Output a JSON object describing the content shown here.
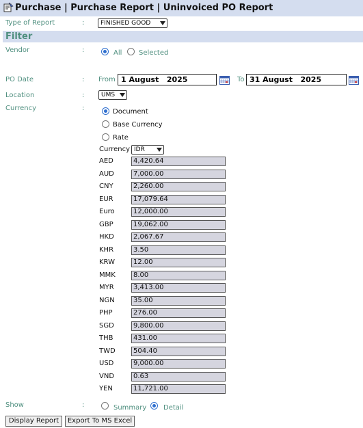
{
  "header": {
    "title": "Purchase | Purchase Report | Uninvoiced PO Report",
    "icon": "report-icon"
  },
  "type_of_report": {
    "label": "Type of Report",
    "colon": ":",
    "value": "FINISHED GOOD"
  },
  "filter": {
    "title": "Filter"
  },
  "vendor": {
    "label": "Vendor",
    "colon": ":",
    "options": [
      {
        "label": "All",
        "checked": true
      },
      {
        "label": "Selected",
        "checked": false
      }
    ]
  },
  "po_date": {
    "label": "PO Date",
    "colon": ":",
    "from_label": "From",
    "from_value": "1 August   2025",
    "to_label": "To",
    "to_value": "31 August   2025"
  },
  "location": {
    "label": "Location",
    "colon": ":",
    "value": "UMS"
  },
  "currency": {
    "label": "Currency",
    "colon": ":",
    "options": [
      {
        "label": "Document",
        "checked": true
      },
      {
        "label": "Base Currency",
        "checked": false
      },
      {
        "label": "Rate",
        "checked": false
      }
    ],
    "rate_currency_label": "Currency",
    "rate_currency_value": "IDR",
    "rates": [
      {
        "code": "AED",
        "value": "4,420.64"
      },
      {
        "code": "AUD",
        "value": "7,000.00"
      },
      {
        "code": "CNY",
        "value": "2,260.00"
      },
      {
        "code": "EUR",
        "value": "17,079.64"
      },
      {
        "code": "Euro",
        "value": "12,000.00"
      },
      {
        "code": "GBP",
        "value": "19,062.00"
      },
      {
        "code": "HKD",
        "value": "2,067.67"
      },
      {
        "code": "KHR",
        "value": "3.50"
      },
      {
        "code": "KRW",
        "value": "12.00"
      },
      {
        "code": "MMK",
        "value": "8.00"
      },
      {
        "code": "MYR",
        "value": "3,413.00"
      },
      {
        "code": "NGN",
        "value": "35.00"
      },
      {
        "code": "PHP",
        "value": "276.00"
      },
      {
        "code": "SGD",
        "value": "9,800.00"
      },
      {
        "code": "THB",
        "value": "431.00"
      },
      {
        "code": "TWD",
        "value": "504.40"
      },
      {
        "code": "USD",
        "value": "9,000.00"
      },
      {
        "code": "VND",
        "value": "0.63"
      },
      {
        "code": "YEN",
        "value": "11,721.00"
      }
    ]
  },
  "show": {
    "label": "Show",
    "colon": ":",
    "options": [
      {
        "label": "Summary",
        "checked": false
      },
      {
        "label": "Detail",
        "checked": true
      }
    ]
  },
  "buttons": {
    "display": "Display Report",
    "export": "Export To MS Excel"
  },
  "colors": {
    "header_bg": "#d4ddef",
    "label_color": "#4f8f7f",
    "rate_box_bg": "#d5d5df",
    "radio_accent": "#2f6fcf"
  }
}
